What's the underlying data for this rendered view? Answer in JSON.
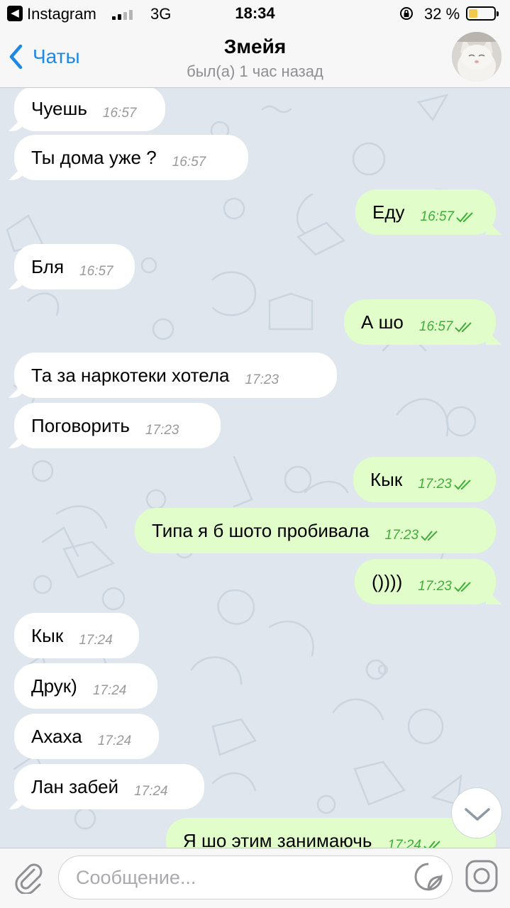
{
  "status_bar": {
    "back_app": "Instagram",
    "network": "3G",
    "time": "18:34",
    "battery_percent": "32 %",
    "battery_level": 0.32
  },
  "header": {
    "back_label": "Чаты",
    "title": "Змейя",
    "subtitle": "был(а) 1 час назад"
  },
  "messages": [
    {
      "text": "Чуешь",
      "time": "16:57"
    },
    {
      "text": "Ты дома уже ?",
      "time": "16:57"
    },
    {
      "text": "Еду",
      "time": "16:57"
    },
    {
      "text": "Бля",
      "time": "16:57"
    },
    {
      "text": "А шо",
      "time": "16:57"
    },
    {
      "text": "Та за наркотеки хотела",
      "time": "17:23"
    },
    {
      "text": "Поговорить",
      "time": "17:23"
    },
    {
      "text": "Кык",
      "time": "17:23"
    },
    {
      "text": "Типа я б шото пробивала",
      "time": "17:23"
    },
    {
      "text": "())))",
      "time": "17:23"
    },
    {
      "text": "Кык",
      "time": "17:24"
    },
    {
      "text": "Друк)",
      "time": "17:24"
    },
    {
      "text": "Ахаха",
      "time": "17:24"
    },
    {
      "text": "Лан забей",
      "time": "17:24"
    },
    {
      "text": "Я шо этим занимаючь",
      "time": "17:24"
    }
  ],
  "input": {
    "placeholder": "Сообщение..."
  },
  "colors": {
    "accent": "#1e88e5",
    "outgoing_bubble": "#e1fdc9",
    "incoming_bubble": "#ffffff",
    "read_ticks": "#3fae3a",
    "chat_background": "#dfe6ee"
  }
}
